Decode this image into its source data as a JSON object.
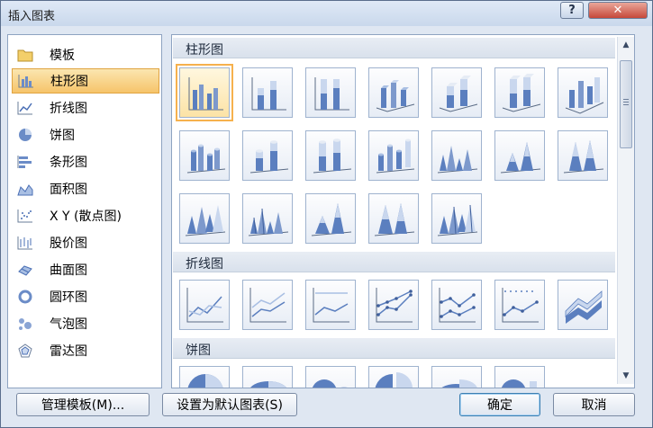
{
  "window": {
    "title": "插入图表",
    "help_label": "?",
    "close_label": "✕"
  },
  "sidebar": {
    "items": [
      {
        "label": "模板",
        "icon": "folder-icon"
      },
      {
        "label": "柱形图",
        "icon": "column-chart-icon",
        "selected": true
      },
      {
        "label": "折线图",
        "icon": "line-chart-icon"
      },
      {
        "label": "饼图",
        "icon": "pie-chart-icon"
      },
      {
        "label": "条形图",
        "icon": "bar-chart-icon"
      },
      {
        "label": "面积图",
        "icon": "area-chart-icon"
      },
      {
        "label": "X Y (散点图)",
        "icon": "scatter-chart-icon"
      },
      {
        "label": "股价图",
        "icon": "stock-chart-icon"
      },
      {
        "label": "曲面图",
        "icon": "surface-chart-icon"
      },
      {
        "label": "圆环图",
        "icon": "doughnut-chart-icon"
      },
      {
        "label": "气泡图",
        "icon": "bubble-chart-icon"
      },
      {
        "label": "雷达图",
        "icon": "radar-chart-icon"
      }
    ]
  },
  "gallery": {
    "sections": [
      {
        "title": "柱形图"
      },
      {
        "title": "折线图"
      },
      {
        "title": "饼图"
      }
    ]
  },
  "buttons": {
    "manage_templates": "管理模板(M)...",
    "set_default": "设置为默认图表(S)",
    "ok": "确定",
    "cancel": "取消"
  },
  "colors": {
    "accent": "#f6b14d",
    "chart_blue": "#5b7fbf",
    "chart_light": "#c9d7ee"
  }
}
